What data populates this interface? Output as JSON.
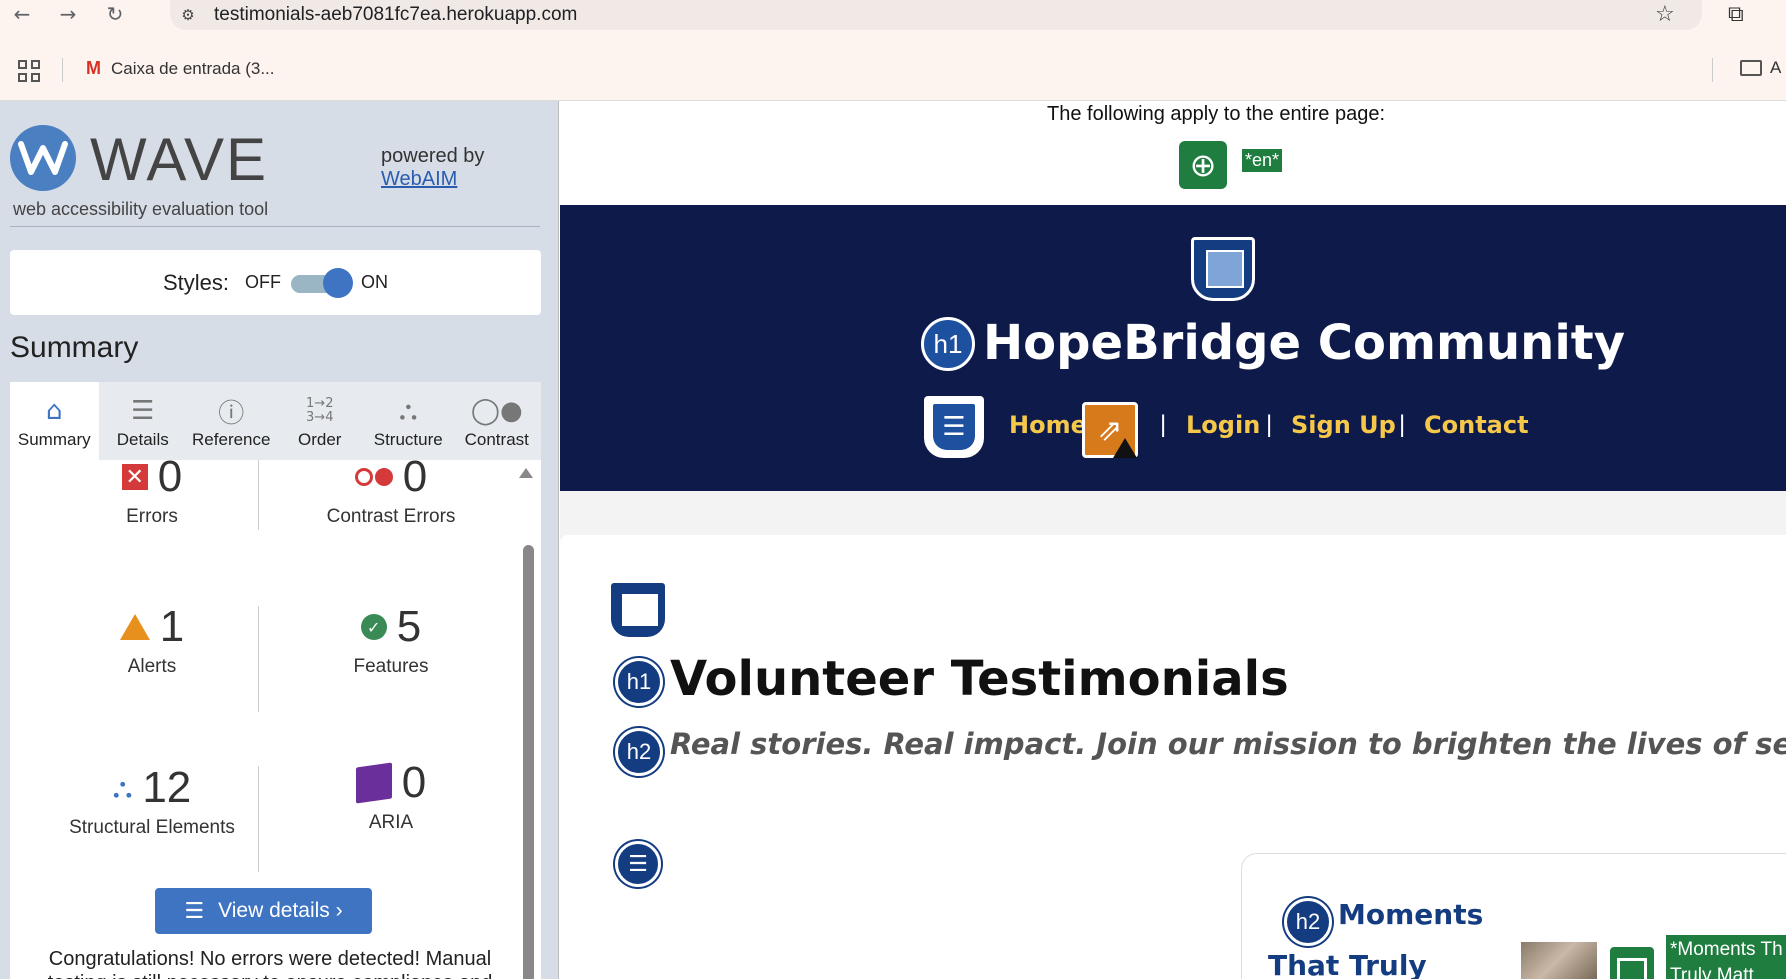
{
  "browser": {
    "url": "testimonials-aeb7081fc7ea.herokuapp.com",
    "bookmark_gmail": "Caixa de entrada (3...",
    "bookmark_folder": "A"
  },
  "wave": {
    "title": "WAVE",
    "subtitle": "web accessibility evaluation tool",
    "powered_by": "powered by",
    "webaim": "WebAIM",
    "styles_label": "Styles:",
    "toggle_off": "OFF",
    "toggle_on": "ON",
    "summary_heading": "Summary",
    "tabs": [
      {
        "label": "Summary",
        "icon": "home-icon"
      },
      {
        "label": "Details",
        "icon": "list-icon"
      },
      {
        "label": "Reference",
        "icon": "info-icon"
      },
      {
        "label": "Order",
        "icon": "order-icon"
      },
      {
        "label": "Structure",
        "icon": "structure-icon"
      },
      {
        "label": "Contrast",
        "icon": "contrast-icon"
      }
    ],
    "stats": {
      "errors": {
        "value": "0",
        "label": "Errors"
      },
      "contrast_errors": {
        "value": "0",
        "label": "Contrast Errors"
      },
      "alerts": {
        "value": "1",
        "label": "Alerts"
      },
      "features": {
        "value": "5",
        "label": "Features"
      },
      "structural": {
        "value": "12",
        "label": "Structural Elements"
      },
      "aria": {
        "value": "0",
        "label": "ARIA"
      }
    },
    "view_details": "View details ›",
    "congrats": "Congratulations! No errors were detected! Manual testing is still necessary to ensure compliance and"
  },
  "page": {
    "apply_text": "The following apply to the entire page:",
    "lang_badge": "*en*",
    "h1_label": "h1",
    "h2_label": "h2",
    "site_title": "HopeBridge Community",
    "nav": {
      "home": "Home",
      "login": "Login",
      "signup": "Sign Up",
      "contact": "Contact",
      "sep": "|"
    },
    "page_title": "Volunteer Testimonials",
    "tagline": "Real stories. Real impact. Join our mission to brighten the lives of seniors and child",
    "card_title": "Moments",
    "card_title2": "That Truly",
    "alt_badge": "*Moments Th Truly Matt"
  },
  "colors": {
    "header_bg": "#0d1a4a",
    "nav_link": "#f5c84a",
    "wave_blue": "#3f74c3",
    "feature_green": "#1f7d3f"
  }
}
